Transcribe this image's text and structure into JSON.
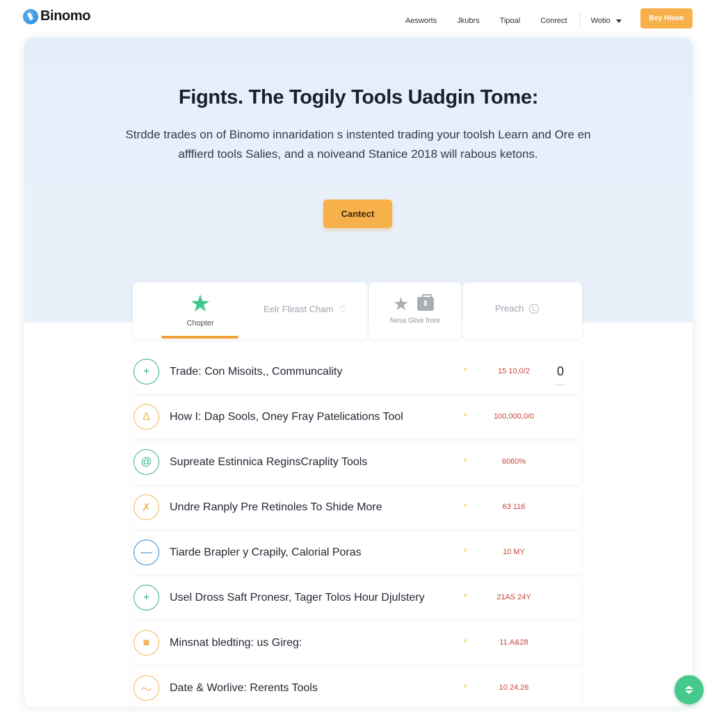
{
  "brand": {
    "name": "Binomo",
    "accent": "#f7b04a",
    "green": "#3ec98a"
  },
  "nav": {
    "links": [
      "Aesworts",
      "Jkubrs",
      "Tipoal",
      "Conrect"
    ],
    "language": "Wotio",
    "cta": "Boy Hlonn"
  },
  "hero": {
    "title": "Fignts. The Togily Tools Uadgin Tome:",
    "subtitle": "Strdde trades on of Binomo innaridation s instented trading your toolsh Learn and Ore en afffierd tools Salies, and a noiveand Stanice 2018 will rabous ketons.",
    "button": "Cantect"
  },
  "tabs": {
    "chapter": "Chopter",
    "first": "Eelr Flirast Cham",
    "middle": "Nesa Glive frore",
    "preach": "Preach"
  },
  "rows": [
    {
      "title": "Trade: Con Misoits,, Communcality",
      "value": "15 10,0/2",
      "count": "0",
      "icon": "plus-icon",
      "glyph": "+",
      "color": "#3aae86"
    },
    {
      "title": "How I: Dap Sools, Oney Fray Patelications Tool",
      "value": "100,000,0/0",
      "count": "",
      "icon": "bell-icon",
      "glyph": "Δ",
      "color": "#f0b85a"
    },
    {
      "title": "Supreate Estinnica ReginsCraplity Tools",
      "value": "6060%",
      "count": "",
      "icon": "swirl-icon",
      "glyph": "@",
      "color": "#3aae86"
    },
    {
      "title": "Undre Ranply Pre Retinoles To Shide More",
      "value": "63 116",
      "count": "",
      "icon": "butterfly-icon",
      "glyph": "✗",
      "color": "#f0b85a"
    },
    {
      "title": "Tiarde Brapler y Crapily, Calorial Poras",
      "value": "10 MY",
      "count": "",
      "icon": "minus-icon",
      "glyph": "—",
      "color": "#3b88c4"
    },
    {
      "title": "Usel Dross Saft Pronesr, Tager Tolos Hour Djulstery",
      "value": "21AS 24Y",
      "count": "",
      "icon": "plus-icon",
      "glyph": "+",
      "color": "#3aae86"
    },
    {
      "title": "Minsnat bledting: us Gireg:",
      "value": "11.A&28",
      "count": "",
      "icon": "square-icon",
      "glyph": "■",
      "color": "#f0b85a"
    },
    {
      "title": "Date & Worlive: Rerents Tools",
      "value": "10 24.26",
      "count": "",
      "icon": "wave-icon",
      "glyph": "〜",
      "color": "#f0b85a"
    }
  ]
}
